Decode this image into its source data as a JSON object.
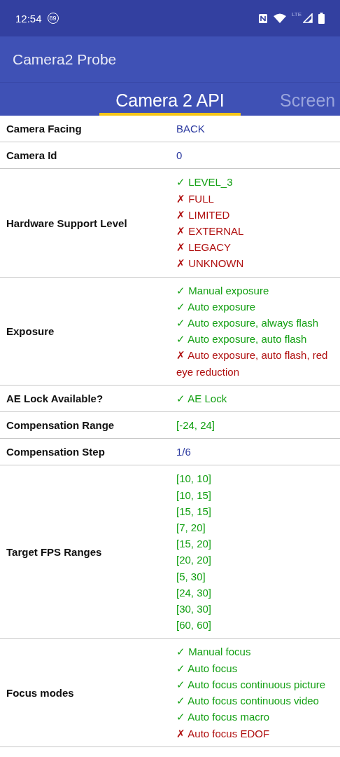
{
  "status_bar": {
    "time": "12:54",
    "badge": "89",
    "network": "LTE"
  },
  "app_bar": {
    "title": "Camera2 Probe"
  },
  "tabs": [
    {
      "label": "Camera 2 API",
      "selected": true
    },
    {
      "label": "Screen",
      "selected": false
    }
  ],
  "rows": [
    {
      "label": "Camera Facing",
      "values": [
        {
          "kind": "plain",
          "text": "BACK"
        }
      ]
    },
    {
      "label": "Camera Id",
      "values": [
        {
          "kind": "plain",
          "text": "0"
        }
      ]
    },
    {
      "label": "Hardware Support Level",
      "values": [
        {
          "kind": "yes",
          "symbol": "✓",
          "text": "LEVEL_3"
        },
        {
          "kind": "no",
          "symbol": "✗",
          "text": "FULL"
        },
        {
          "kind": "no",
          "symbol": "✗",
          "text": "LIMITED"
        },
        {
          "kind": "no",
          "symbol": "✗",
          "text": "EXTERNAL"
        },
        {
          "kind": "no",
          "symbol": "✗",
          "text": "LEGACY"
        },
        {
          "kind": "no",
          "symbol": "✗",
          "text": "UNKNOWN"
        }
      ]
    },
    {
      "label": "Exposure",
      "values": [
        {
          "kind": "yes",
          "symbol": "✓",
          "text": "Manual exposure"
        },
        {
          "kind": "yes",
          "symbol": "✓",
          "text": "Auto exposure"
        },
        {
          "kind": "yes",
          "symbol": "✓",
          "text": "Auto exposure, always flash"
        },
        {
          "kind": "yes",
          "symbol": "✓",
          "text": "Auto exposure, auto flash"
        },
        {
          "kind": "no",
          "symbol": "✗",
          "text": "Auto exposure, auto flash, red eye reduction"
        }
      ]
    },
    {
      "label": "AE Lock Available?",
      "values": [
        {
          "kind": "yes",
          "symbol": "✓",
          "text": "AE Lock"
        }
      ]
    },
    {
      "label": "Compensation Range",
      "values": [
        {
          "kind": "yes",
          "text": "[-24, 24]"
        }
      ]
    },
    {
      "label": "Compensation Step",
      "values": [
        {
          "kind": "plain",
          "text": "1/6"
        }
      ]
    },
    {
      "label": "Target FPS Ranges",
      "values": [
        {
          "kind": "yes",
          "text": "[10, 10]"
        },
        {
          "kind": "yes",
          "text": "[10, 15]"
        },
        {
          "kind": "yes",
          "text": "[15, 15]"
        },
        {
          "kind": "yes",
          "text": "[7, 20]"
        },
        {
          "kind": "yes",
          "text": "[15, 20]"
        },
        {
          "kind": "yes",
          "text": "[20, 20]"
        },
        {
          "kind": "yes",
          "text": "[5, 30]"
        },
        {
          "kind": "yes",
          "text": "[24, 30]"
        },
        {
          "kind": "yes",
          "text": "[30, 30]"
        },
        {
          "kind": "yes",
          "text": "[60, 60]"
        }
      ]
    },
    {
      "label": "Focus modes",
      "values": [
        {
          "kind": "yes",
          "symbol": "✓",
          "text": "Manual focus"
        },
        {
          "kind": "yes",
          "symbol": "✓",
          "text": "Auto focus"
        },
        {
          "kind": "yes",
          "symbol": "✓",
          "text": "Auto focus continuous picture"
        },
        {
          "kind": "yes",
          "symbol": "✓",
          "text": "Auto focus continuous video"
        },
        {
          "kind": "yes",
          "symbol": "✓",
          "text": "Auto focus macro"
        },
        {
          "kind": "no",
          "symbol": "✗",
          "text": "Auto focus EDOF"
        }
      ]
    }
  ]
}
